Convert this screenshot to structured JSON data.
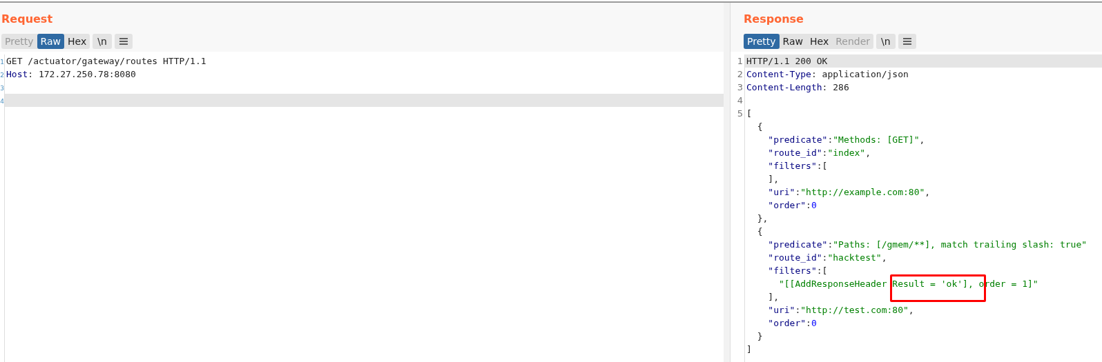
{
  "panes": [
    {
      "title": "Request",
      "tabs": [
        {
          "label": "Pretty",
          "selected": false,
          "disabled": true
        },
        {
          "label": "Raw",
          "selected": true,
          "disabled": false
        },
        {
          "label": "Hex",
          "selected": false,
          "disabled": false
        }
      ],
      "newline_button": "\\n",
      "lines": [
        {
          "number": "1",
          "highlighted": false,
          "segments": [
            {
              "kind": "plain",
              "text": "GET /actuator/gateway/routes HTTP/1.1"
            }
          ]
        },
        {
          "number": "2",
          "highlighted": false,
          "segments": [
            {
              "kind": "name",
              "text": "Host"
            },
            {
              "kind": "plain",
              "text": ": 172.27.250.78:8080"
            }
          ]
        },
        {
          "number": "3",
          "highlighted": false
        },
        {
          "number": "4",
          "highlighted": true
        }
      ]
    },
    {
      "title": "Response",
      "tabs": [
        {
          "label": "Pretty",
          "selected": true,
          "disabled": false
        },
        {
          "label": "Raw",
          "selected": false,
          "disabled": false
        },
        {
          "label": "Hex",
          "selected": false,
          "disabled": false
        },
        {
          "label": "Render",
          "selected": false,
          "disabled": true
        }
      ],
      "newline_button": "\\n",
      "lines": [
        {
          "number": "1",
          "highlighted": true,
          "segments": [
            {
              "kind": "plain",
              "text": "HTTP/1.1 200 OK"
            }
          ]
        },
        {
          "number": "2",
          "highlighted": false,
          "segments": [
            {
              "kind": "name",
              "text": "Content-Type"
            },
            {
              "kind": "plain",
              "text": ": application/json"
            }
          ]
        },
        {
          "number": "3",
          "highlighted": false,
          "segments": [
            {
              "kind": "name",
              "text": "Content-Length"
            },
            {
              "kind": "plain",
              "text": ": 286"
            }
          ]
        },
        {
          "number": "4",
          "highlighted": false
        },
        {
          "number": "5",
          "highlighted": false,
          "segments": [
            {
              "kind": "plain",
              "text": "["
            }
          ]
        },
        {
          "highlighted": false,
          "segments": [
            {
              "kind": "plain",
              "text": "  {"
            }
          ]
        },
        {
          "highlighted": false,
          "segments": [
            {
              "kind": "key",
              "text": "    \"predicate\""
            },
            {
              "kind": "plain",
              "text": ":"
            },
            {
              "kind": "string",
              "text": "\"Methods: [GET]\""
            },
            {
              "kind": "plain",
              "text": ","
            }
          ]
        },
        {
          "highlighted": false,
          "segments": [
            {
              "kind": "key",
              "text": "    \"route_id\""
            },
            {
              "kind": "plain",
              "text": ":"
            },
            {
              "kind": "string",
              "text": "\"index\""
            },
            {
              "kind": "plain",
              "text": ","
            }
          ]
        },
        {
          "highlighted": false,
          "segments": [
            {
              "kind": "key",
              "text": "    \"filters\""
            },
            {
              "kind": "plain",
              "text": ":["
            }
          ]
        },
        {
          "highlighted": false,
          "segments": [
            {
              "kind": "plain",
              "text": "    ],"
            }
          ]
        },
        {
          "highlighted": false,
          "segments": [
            {
              "kind": "key",
              "text": "    \"uri\""
            },
            {
              "kind": "plain",
              "text": ":"
            },
            {
              "kind": "string",
              "text": "\"http://example.com:80\""
            },
            {
              "kind": "plain",
              "text": ","
            }
          ]
        },
        {
          "highlighted": false,
          "segments": [
            {
              "kind": "key",
              "text": "    \"order\""
            },
            {
              "kind": "plain",
              "text": ":"
            },
            {
              "kind": "number",
              "text": "0"
            }
          ]
        },
        {
          "highlighted": false,
          "segments": [
            {
              "kind": "plain",
              "text": "  },"
            }
          ]
        },
        {
          "highlighted": false,
          "segments": [
            {
              "kind": "plain",
              "text": "  {"
            }
          ]
        },
        {
          "highlighted": false,
          "segments": [
            {
              "kind": "key",
              "text": "    \"predicate\""
            },
            {
              "kind": "plain",
              "text": ":"
            },
            {
              "kind": "string",
              "text": "\"Paths: [/gmem/**], match trailing slash: true\""
            }
          ]
        },
        {
          "highlighted": false,
          "segments": [
            {
              "kind": "key",
              "text": "    \"route_id\""
            },
            {
              "kind": "plain",
              "text": ":"
            },
            {
              "kind": "string",
              "text": "\"hacktest\""
            },
            {
              "kind": "plain",
              "text": ","
            }
          ]
        },
        {
          "highlighted": false,
          "segments": [
            {
              "kind": "key",
              "text": "    \"filters\""
            },
            {
              "kind": "plain",
              "text": ":["
            }
          ]
        },
        {
          "highlighted": false,
          "segments": [
            {
              "kind": "string",
              "text": "      \"[[AddResponseHeader "
            },
            {
              "kind": "string",
              "text": "Result = 'ok'], ",
              "annotation": {
                "kind": "rectangle",
                "color": "#ff0000"
              }
            },
            {
              "kind": "string",
              "text": "order = 1]\""
            }
          ]
        },
        {
          "highlighted": false,
          "segments": [
            {
              "kind": "plain",
              "text": "    ],"
            }
          ]
        },
        {
          "highlighted": false,
          "segments": [
            {
              "kind": "key",
              "text": "    \"uri\""
            },
            {
              "kind": "plain",
              "text": ":"
            },
            {
              "kind": "string",
              "text": "\"http://test.com:80\""
            },
            {
              "kind": "plain",
              "text": ","
            }
          ]
        },
        {
          "highlighted": false,
          "segments": [
            {
              "kind": "key",
              "text": "    \"order\""
            },
            {
              "kind": "plain",
              "text": ":"
            },
            {
              "kind": "number",
              "text": "0"
            }
          ]
        },
        {
          "highlighted": false,
          "segments": [
            {
              "kind": "plain",
              "text": "  }"
            }
          ]
        },
        {
          "highlighted": false,
          "segments": [
            {
              "kind": "plain",
              "text": "]"
            }
          ]
        }
      ]
    }
  ]
}
